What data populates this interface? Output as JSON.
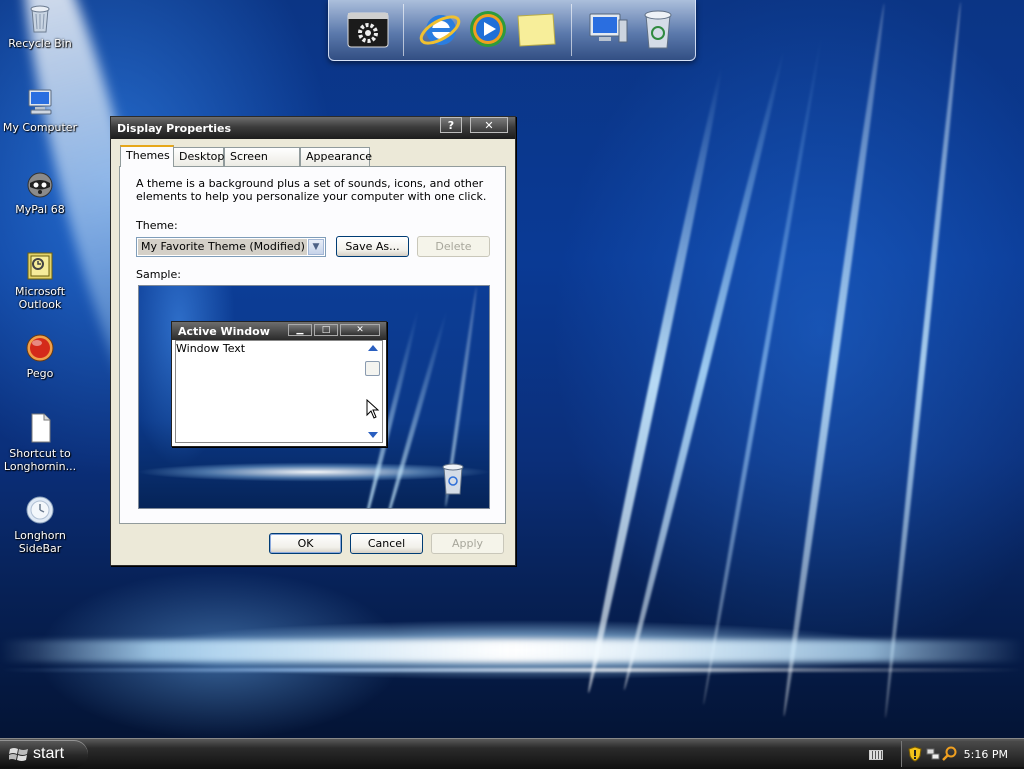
{
  "desktop": {
    "icons": [
      {
        "label": "Recycle Bin",
        "icon": "recycle-bin-icon"
      },
      {
        "label": "My Computer",
        "icon": "computer-icon"
      },
      {
        "label": "MyPal 68",
        "icon": "raccoon-browser-icon"
      },
      {
        "label": "Microsoft Outlook",
        "icon": "outlook-icon"
      },
      {
        "label": "Pego",
        "icon": "red-orb-icon"
      },
      {
        "label": "Shortcut to Longhornin...",
        "icon": "document-icon"
      },
      {
        "label": "Longhorn SideBar",
        "icon": "sidebar-clock-icon"
      }
    ]
  },
  "dock": {
    "items": [
      "settings-icon",
      "internet-explorer-icon",
      "media-player-icon",
      "sticky-note-icon",
      "computer-icon",
      "recycle-bin-icon"
    ]
  },
  "dialog": {
    "title": "Display Properties",
    "help_label": "?",
    "close_label": "✕",
    "tabs": [
      {
        "label": "Themes",
        "active": true
      },
      {
        "label": "Desktop",
        "active": false
      },
      {
        "label": "Screen Saver",
        "active": false
      },
      {
        "label": "Appearance",
        "active": false
      }
    ],
    "description": "A theme is a background plus a set of sounds, icons, and other elements to help you personalize your computer with one click.",
    "theme_label": "Theme:",
    "theme_value": "My Favorite Theme (Modified)",
    "save_as_label": "Save As...",
    "delete_label": "Delete",
    "sample_label": "Sample:",
    "sample": {
      "window_title": "Active Window",
      "window_text": "Window Text"
    },
    "ok_label": "OK",
    "cancel_label": "Cancel",
    "apply_label": "Apply"
  },
  "taskbar": {
    "start_label": "start",
    "clock": "5:16 PM"
  },
  "colors": {
    "desktop_blue": "#0b3585",
    "dialog_face": "#ece9d8",
    "tab_accent": "#e6a71a",
    "button_border": "#003c74"
  }
}
